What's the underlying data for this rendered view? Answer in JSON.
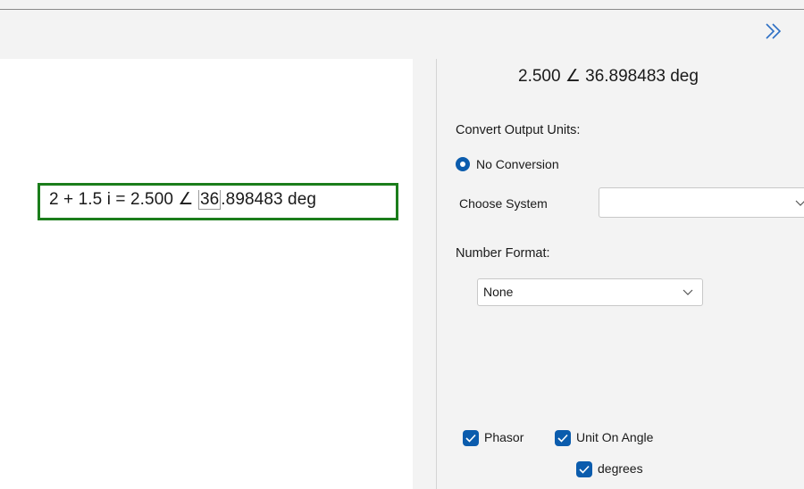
{
  "toolbar": {
    "collapse_icon": "chevron-double-right-icon"
  },
  "canvas": {
    "expression_prefix": "2 + 1.5 i =  2.500 ∠ ",
    "expression_cursor": "36",
    "expression_suffix": ".898483 deg"
  },
  "panel": {
    "result": "2.500 ∠  36.898483 deg",
    "convert_units_label": "Convert Output Units:",
    "no_conversion_label": "No Conversion",
    "choose_system_label": "Choose System",
    "choose_system_value": "",
    "number_format_label": "Number Format:",
    "number_format_value": "None",
    "phasor_label": "Phasor",
    "unit_on_angle_label": "Unit On Angle",
    "degrees_label": "degrees",
    "phasor_checked": true,
    "unit_on_angle_checked": true,
    "degrees_checked": true
  },
  "colors": {
    "accent": "#0b5cad",
    "result_border": "#1b7d1b"
  }
}
